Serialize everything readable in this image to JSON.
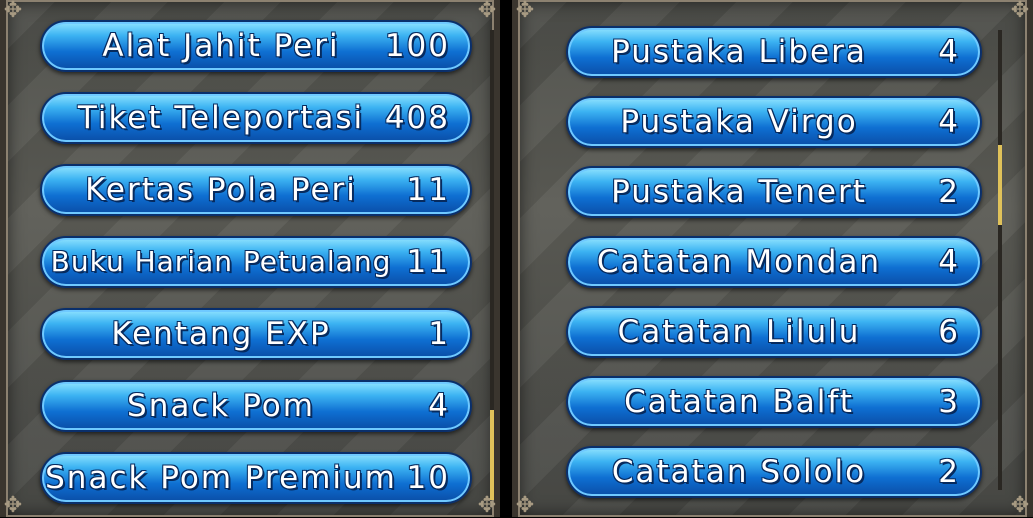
{
  "left_list": [
    {
      "name": "Alat Jahit Peri",
      "count": "100"
    },
    {
      "name": "Tiket Teleportasi",
      "count": "408"
    },
    {
      "name": "Kertas Pola Peri",
      "count": "11"
    },
    {
      "name": "Buku Harian Petualang",
      "count": "11"
    },
    {
      "name": "Kentang EXP",
      "count": "1"
    },
    {
      "name": "Snack Pom",
      "count": "4"
    },
    {
      "name": "Snack Pom Premium",
      "count": "10"
    }
  ],
  "right_list": [
    {
      "name": "Pustaka Libera",
      "count": "4"
    },
    {
      "name": "Pustaka Virgo",
      "count": "4"
    },
    {
      "name": "Pustaka Tenert",
      "count": "2"
    },
    {
      "name": "Catatan Mondan",
      "count": "4"
    },
    {
      "name": "Catatan Lilulu",
      "count": "6"
    },
    {
      "name": "Catatan Balft",
      "count": "3"
    },
    {
      "name": "Catatan Sololo",
      "count": "2"
    }
  ],
  "scroll": {
    "left_position": 0.9,
    "right_position": 0.35
  },
  "colors": {
    "button_top": "#8fe3ff",
    "button_bottom": "#0a4da6",
    "scroll_thumb": "#e0c25a"
  },
  "icons": {
    "corner": "ornate-corner-icon"
  }
}
